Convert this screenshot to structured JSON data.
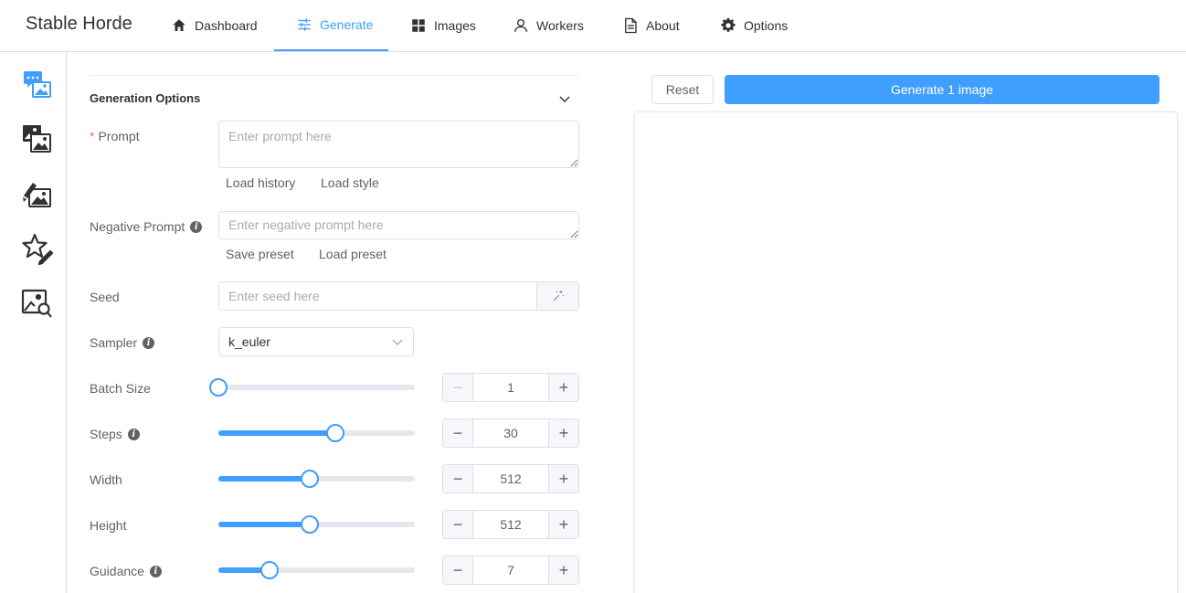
{
  "app": {
    "title": "Stable Horde"
  },
  "nav": {
    "items": [
      {
        "label": "Dashboard",
        "icon": "home-icon"
      },
      {
        "label": "Generate",
        "icon": "sliders-icon",
        "active": true
      },
      {
        "label": "Images",
        "icon": "grid-icon"
      },
      {
        "label": "Workers",
        "icon": "user-icon"
      },
      {
        "label": "About",
        "icon": "document-icon"
      },
      {
        "label": "Options",
        "icon": "gear-icon"
      }
    ]
  },
  "sidebar": {
    "items": [
      {
        "icon": "text-to-image-icon"
      },
      {
        "icon": "image-to-image-icon"
      },
      {
        "icon": "inpainting-icon"
      },
      {
        "icon": "rate-icon"
      },
      {
        "icon": "interrogate-icon"
      }
    ]
  },
  "form": {
    "section_title": "Generation Options",
    "prompt": {
      "label": "Prompt",
      "required_mark": "*",
      "placeholder": "Enter prompt here",
      "value": ""
    },
    "load_history": "Load history",
    "load_style": "Load style",
    "negative_prompt": {
      "label": "Negative Prompt",
      "placeholder": "Enter negative prompt here",
      "value": ""
    },
    "save_preset": "Save preset",
    "load_preset": "Load preset",
    "seed": {
      "label": "Seed",
      "placeholder": "Enter seed here",
      "value": ""
    },
    "sampler": {
      "label": "Sampler",
      "value": "k_euler"
    },
    "batch_size": {
      "label": "Batch Size",
      "value": "1",
      "fraction": 0.0
    },
    "steps": {
      "label": "Steps",
      "value": "30",
      "fraction": 0.595
    },
    "width": {
      "label": "Width",
      "value": "512",
      "fraction": 0.465
    },
    "height": {
      "label": "Height",
      "value": "512",
      "fraction": 0.465
    },
    "guidance": {
      "label": "Guidance",
      "value": "7",
      "fraction": 0.26
    }
  },
  "actions": {
    "reset_label": "Reset",
    "generate_label": "Generate 1 image"
  },
  "colors": {
    "accent": "#409eff",
    "border": "#dcdfe6",
    "required": "#f56c6c"
  }
}
